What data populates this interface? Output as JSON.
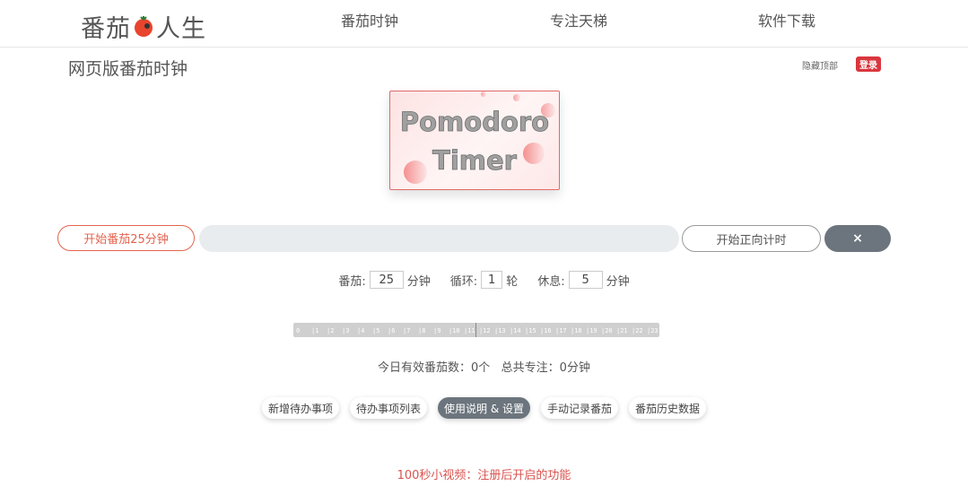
{
  "header": {
    "logo_left": "番茄",
    "logo_right": "人生",
    "nav": [
      "番茄时钟",
      "专注天梯",
      "软件下载"
    ]
  },
  "page": {
    "title": "网页版番茄时钟",
    "hide_top": "隐藏顶部",
    "login": "登录"
  },
  "hero": {
    "line1": "Pomodoro",
    "line2": "Timer"
  },
  "controls": {
    "start": "开始番茄25分钟",
    "count_up": "开始正向计时",
    "close": "×"
  },
  "settings": {
    "tomato_label": "番茄:",
    "tomato_value": "25",
    "tomato_unit": "分钟",
    "cycle_label": "循环:",
    "cycle_value": "1",
    "cycle_unit": "轮",
    "rest_label": "休息:",
    "rest_value": "5",
    "rest_unit": "分钟"
  },
  "timeline": {
    "hours": [
      "0",
      "1",
      "2",
      "3",
      "4",
      "5",
      "6",
      "7",
      "8",
      "9",
      "10",
      "11",
      "12",
      "13",
      "14",
      "15",
      "16",
      "17",
      "18",
      "19",
      "20",
      "21",
      "22",
      "23"
    ]
  },
  "stats": {
    "text": "今日有效番茄数：0个   总共专注：0分钟"
  },
  "actions": [
    "新增待办事项",
    "待办事项列表",
    "使用说明 & 设置",
    "手动记录番茄",
    "番茄历史数据"
  ],
  "footer": {
    "link": "100秒小视频：注册后开启的功能"
  },
  "colors": {
    "accent": "#e3644f",
    "dark_button": "#6c757d",
    "login_red": "#d9363e"
  }
}
